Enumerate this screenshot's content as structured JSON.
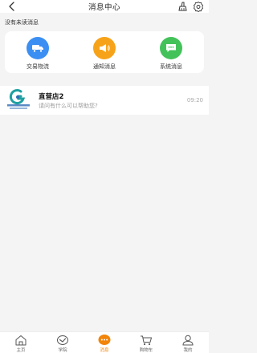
{
  "header": {
    "title": "消息中心",
    "back_icon": "chevron-left-icon",
    "right_icons": [
      "broom-icon",
      "gear-icon"
    ]
  },
  "unread_notice": "没有未读消息",
  "categories": [
    {
      "label": "交易物流",
      "icon": "truck-icon",
      "color": "#3b8ff3"
    },
    {
      "label": "通知消息",
      "icon": "megaphone-icon",
      "color": "#f7a319"
    },
    {
      "label": "系统消息",
      "icon": "chat-bubble-icon",
      "color": "#44c25a"
    }
  ],
  "messages": [
    {
      "name": "直营店2",
      "preview": "请问有什么可以帮助您?",
      "time": "09:20",
      "avatar": "store-logo-icon"
    }
  ],
  "tabbar": {
    "items": [
      {
        "label": "主页",
        "icon": "home-icon"
      },
      {
        "label": "学院",
        "icon": "academy-icon"
      },
      {
        "label": "消息",
        "icon": "message-icon",
        "active": true
      },
      {
        "label": "购物车",
        "icon": "cart-icon"
      },
      {
        "label": "我的",
        "icon": "profile-icon"
      }
    ],
    "active_color": "#f2840a"
  }
}
